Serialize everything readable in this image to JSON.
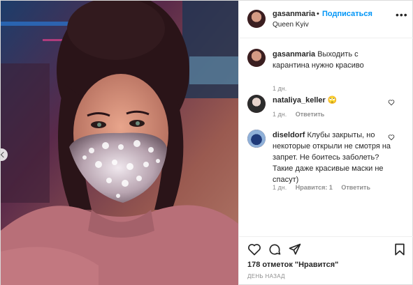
{
  "post": {
    "author": {
      "username": "gasanmaria",
      "separator": "•",
      "follow_label": "Подписаться",
      "location": "Queen Kyiv",
      "more_label": "•••"
    },
    "comments": [
      {
        "username": "gasanmaria",
        "text": "Выходить с карантина нужно красиво",
        "time": "1 дн.",
        "avatar_color": "#6b3b3f"
      },
      {
        "username": "nataliya_keller",
        "text": "🙄",
        "time": "1 дн.",
        "reply_label": "Ответить",
        "avatar_color": "#3a3a3a"
      },
      {
        "username": "diseldorf",
        "text": "Клубы закрыты, но некоторые открыли не смотря на запрет. Не боитесь заболеть? Такие даже красивые маски не спасут)",
        "time": "1 дн.",
        "likes_label": "Нравится: 1",
        "reply_label": "Ответить",
        "avatar_color": "#2a4f8a"
      }
    ],
    "actions": {
      "like_icon": "heart-icon",
      "comment_icon": "comment-icon",
      "share_icon": "share-icon",
      "save_icon": "bookmark-icon"
    },
    "likes_text": "178 отметок \"Нравится\"",
    "date_text": "ДЕНЬ НАЗАД"
  },
  "colors": {
    "link_blue": "#0095f6",
    "text": "#262626",
    "muted": "#8e8e8e",
    "border": "#efefef"
  }
}
